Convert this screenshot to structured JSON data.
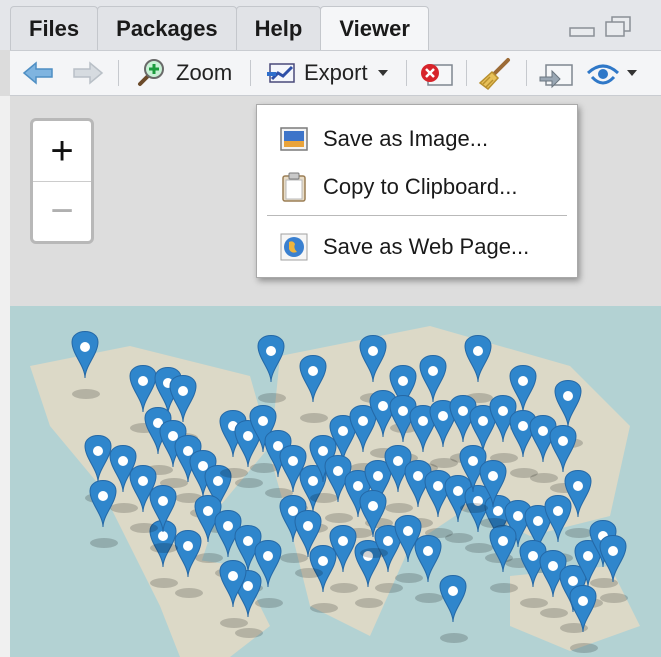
{
  "tabs": [
    {
      "label": "Files",
      "active": false
    },
    {
      "label": "Packages",
      "active": false
    },
    {
      "label": "Help",
      "active": false
    },
    {
      "label": "Viewer",
      "active": true
    }
  ],
  "toolbar": {
    "zoom_label": "Zoom",
    "export_label": "Export"
  },
  "export_menu": {
    "items": [
      {
        "label": "Save as Image...",
        "icon": "image-icon"
      },
      {
        "label": "Copy to Clipboard...",
        "icon": "clipboard-icon"
      },
      {
        "label": "Save as Web Page...",
        "icon": "globe-icon"
      }
    ]
  },
  "map": {
    "zoom_in_label": "+",
    "zoom_out_label": "−",
    "marker_color": "#2f86cc",
    "water_color": "#b3d2d3"
  }
}
